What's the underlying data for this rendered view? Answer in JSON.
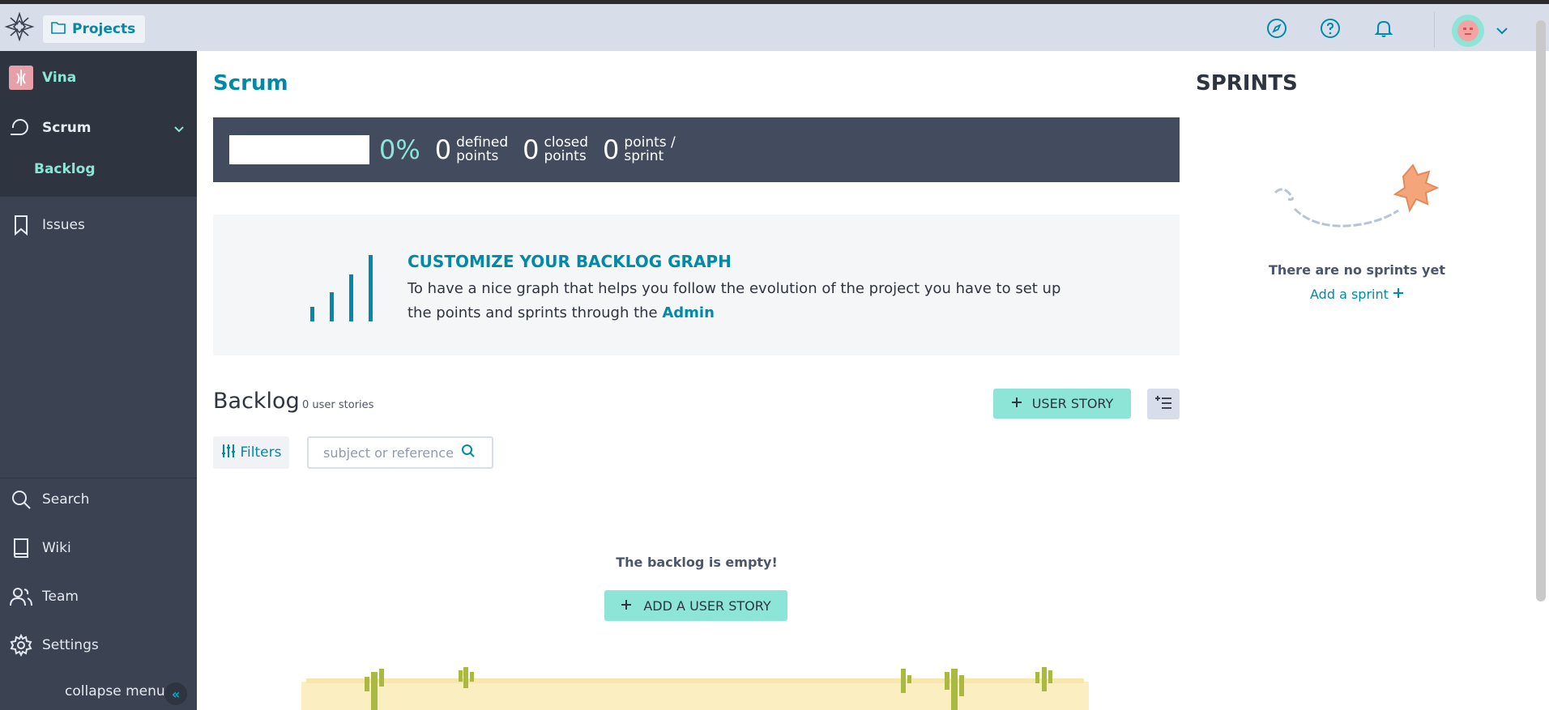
{
  "header": {
    "projects_label": "Projects",
    "icons": [
      "logo-icon",
      "folder-icon",
      "compass-icon",
      "help-icon",
      "bell-icon",
      "avatar",
      "chevron-down-icon"
    ]
  },
  "sidebar": {
    "project_name": "Vina",
    "scrum_label": "Scrum",
    "backlog_label": "Backlog",
    "issues_label": "Issues",
    "bottom_items": [
      {
        "label": "Search",
        "icon": "search-icon"
      },
      {
        "label": "Wiki",
        "icon": "book-icon"
      },
      {
        "label": "Team",
        "icon": "team-icon"
      },
      {
        "label": "Settings",
        "icon": "gear-icon"
      }
    ],
    "collapse_label": "collapse menu"
  },
  "main": {
    "title": "Scrum",
    "summary": {
      "progress": 0,
      "percent": "0%",
      "defined_points": "0",
      "defined_label_1": "defined",
      "defined_label_2": "points",
      "closed_points": "0",
      "closed_label_1": "closed",
      "closed_label_2": "points",
      "points_per_sprint": "0",
      "pps_label_1": "points /",
      "pps_label_2": "sprint"
    },
    "graph_promo": {
      "title": "CUSTOMIZE YOUR BACKLOG GRAPH",
      "text": "To have a nice graph that helps you follow the evolution of the project you have to set up the points and sprints through the ",
      "link": "Admin"
    },
    "backlog": {
      "title": "Backlog",
      "count": "0 user stories",
      "add_button": "USER STORY",
      "filters_label": "Filters",
      "search_placeholder": "subject or reference",
      "empty_text": "The backlog is empty!",
      "add_story_button": "ADD A USER STORY"
    }
  },
  "sprints": {
    "title": "SPRINTS",
    "empty_text": "There are no sprints yet",
    "add_label": "Add a sprint"
  },
  "colors": {
    "accent": "#008aa8",
    "mint": "#8ce5d6",
    "sidebar": "#3b4252",
    "sidebar_dark": "#2e3440",
    "summary_bg": "#434c5e"
  }
}
